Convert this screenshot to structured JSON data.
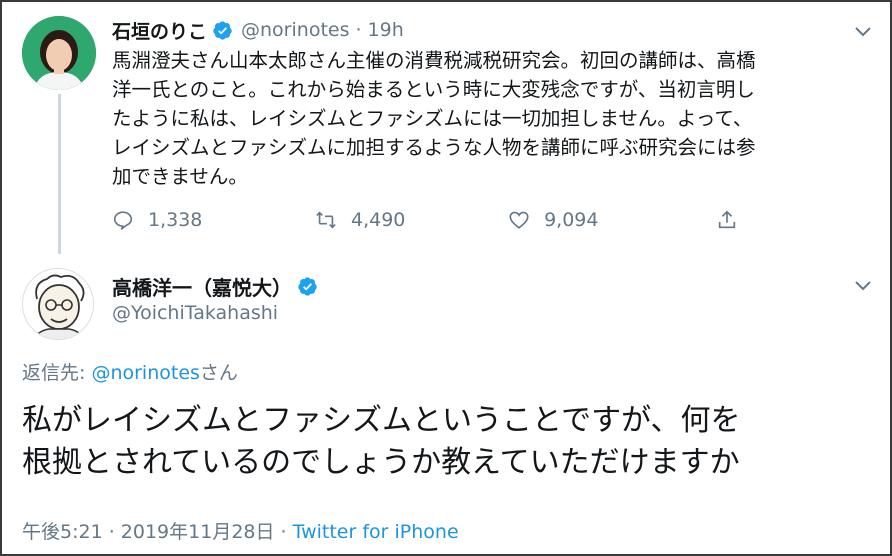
{
  "tweet1": {
    "author_name": "石垣のりこ",
    "handle": "@norinotes",
    "separator": "·",
    "time": "19h",
    "text": "馬淵澄夫さん山本太郎さん主催の消費税減税研究会。初回の講師は、高橋\n洋一氏とのこと。これから始まるという時に大変残念ですが、当初言明し\nたように私は、レイシズムとファシズムには一切加担しません。よって、\nレイシズムとファシズムに加担するような人物を講師に呼ぶ研究会には参\n加できません。",
    "reply_count": "1,338",
    "retweet_count": "4,490",
    "like_count": "9,094",
    "icons": [
      "verified-badge-icon",
      "chevron-down-icon",
      "reply-icon",
      "retweet-icon",
      "like-icon",
      "share-icon"
    ]
  },
  "tweet2": {
    "author_name": "高橋洋一（嘉悦大）",
    "handle": "@YoichiTakahashi",
    "reply_prefix": "返信先: ",
    "reply_target": "@norinotes",
    "reply_suffix": "さん",
    "text": "私がレイシズムとファシズムということですが、何を\n根拠とされているのでしょうか教えていただけますか",
    "timestamp": "午後5:21 · 2019年11月28日 · ",
    "source": "Twitter for iPhone"
  },
  "colors": {
    "accent": "#1b95e0",
    "verified": "#1da1f2",
    "muted": "#657786",
    "text": "#14171a",
    "thread_line": "#ccd6dd"
  }
}
